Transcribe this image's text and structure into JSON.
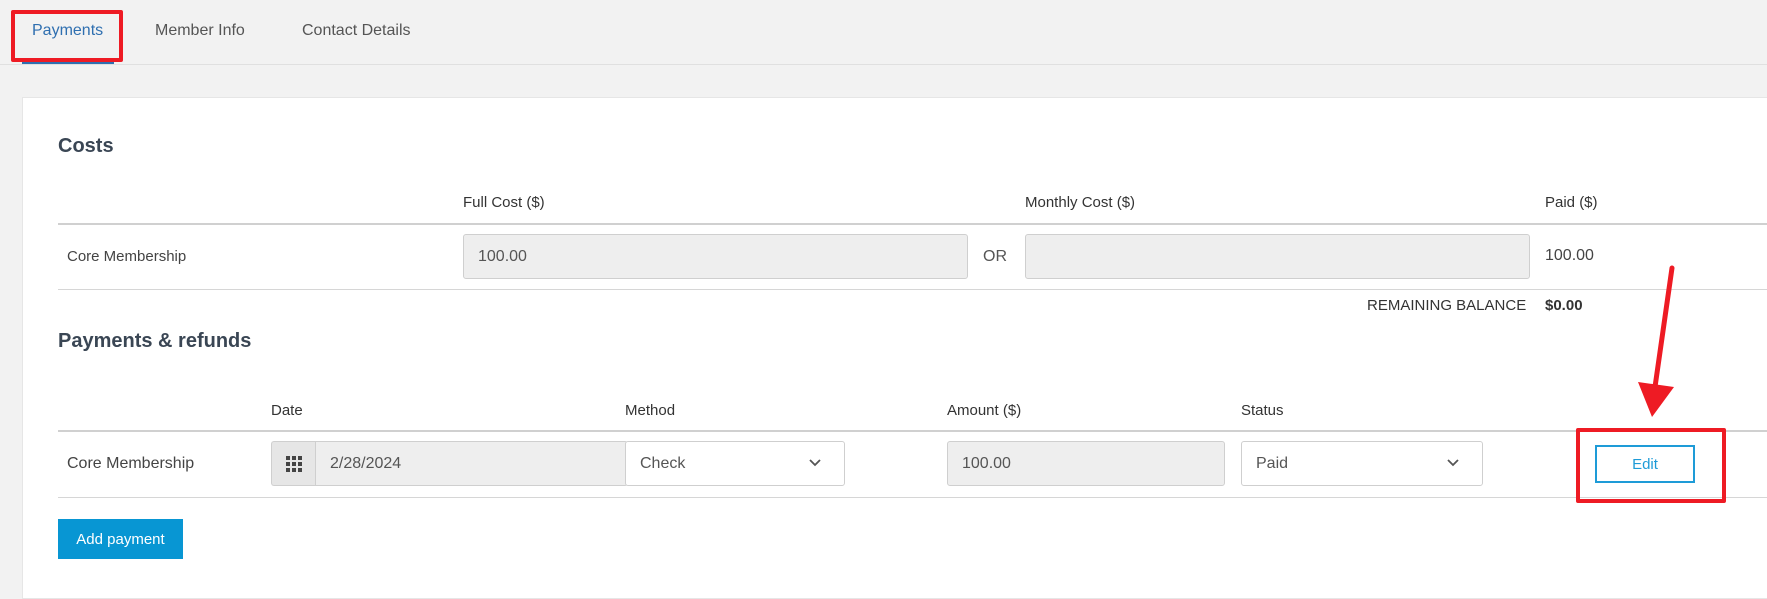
{
  "tabs": [
    {
      "label": "Payments",
      "active": true
    },
    {
      "label": "Member Info",
      "active": false
    },
    {
      "label": "Contact Details",
      "active": false
    }
  ],
  "costs": {
    "title": "Costs",
    "headers": {
      "full_cost": "Full Cost ($)",
      "monthly_cost": "Monthly Cost ($)",
      "paid": "Paid ($)"
    },
    "row": {
      "item": "Core Membership",
      "full_cost": "100.00",
      "or_label": "OR",
      "monthly_cost": "",
      "paid": "100.00"
    },
    "remaining_label": "REMAINING BALANCE",
    "remaining_value": "$0.00"
  },
  "payments": {
    "title": "Payments & refunds",
    "headers": {
      "date": "Date",
      "method": "Method",
      "amount": "Amount ($)",
      "status": "Status"
    },
    "row": {
      "item": "Core Membership",
      "date": "2/28/2024",
      "method": "Check",
      "amount": "100.00",
      "status": "Paid",
      "edit_label": "Edit"
    },
    "add_button": "Add payment"
  },
  "icons": {
    "calendar": "calendar-grid-icon",
    "dropdown": "chevron-down-icon"
  },
  "colors": {
    "accent": "#2f6fb0",
    "primary_button": "#0896d3",
    "edit_button": "#1e9bd7",
    "annotation": "#ee1b24"
  }
}
